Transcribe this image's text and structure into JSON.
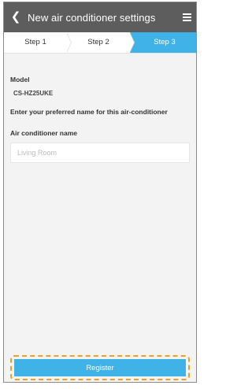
{
  "header": {
    "title": "New air conditioner settings",
    "back_icon": "chevron-left-icon",
    "menu_icon": "hamburger-menu-icon"
  },
  "steps": [
    {
      "label": "Step 1"
    },
    {
      "label": "Step 2"
    },
    {
      "label": "Step 3"
    }
  ],
  "active_step": 3,
  "form": {
    "model_label": "Model",
    "model_value": "CS-HZ25UKE",
    "instruction": "Enter your preferred name for this air-conditioner",
    "name_label": "Air conditioner name",
    "name_placeholder": "Living Room",
    "name_value": ""
  },
  "actions": {
    "register_label": "Register"
  },
  "colors": {
    "header": "#5d5d5d",
    "accent": "#3fb2e8",
    "highlight_dashed": "#f0a020",
    "background": "#f3f3f3"
  }
}
